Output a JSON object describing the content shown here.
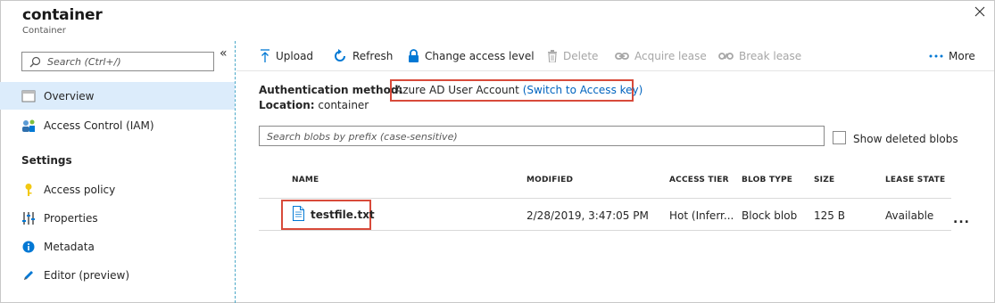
{
  "header": {
    "title": "container",
    "subtitle": "Container"
  },
  "sidebar": {
    "search_placeholder": "Search (Ctrl+/)",
    "collapse_glyph": "«",
    "items": [
      {
        "label": "Overview",
        "icon": "overview-icon"
      },
      {
        "label": "Access Control (IAM)",
        "icon": "iam-icon"
      }
    ],
    "settings_heading": "Settings",
    "settings_items": [
      {
        "label": "Access policy",
        "icon": "key-icon"
      },
      {
        "label": "Properties",
        "icon": "properties-icon"
      },
      {
        "label": "Metadata",
        "icon": "info-icon"
      },
      {
        "label": "Editor (preview)",
        "icon": "pencil-icon"
      }
    ]
  },
  "toolbar": {
    "upload": "Upload",
    "refresh": "Refresh",
    "change_access": "Change access level",
    "delete": "Delete",
    "acquire_lease": "Acquire lease",
    "break_lease": "Break lease",
    "more": "More"
  },
  "auth": {
    "label": "Authentication method:",
    "value": "Azure AD User Account",
    "switch_link": "(Switch to Access key)",
    "location_label": "Location:",
    "location_value": "container"
  },
  "blob_search": {
    "placeholder": "Search blobs by prefix (case-sensitive)",
    "show_deleted": "Show deleted blobs"
  },
  "table": {
    "columns": [
      "NAME",
      "MODIFIED",
      "ACCESS TIER",
      "BLOB TYPE",
      "SIZE",
      "LEASE STATE"
    ],
    "rows": [
      {
        "name": "testfile.txt",
        "modified": "2/28/2019, 3:47:05 PM",
        "access_tier": "Hot (Inferr...",
        "blob_type": "Block blob",
        "size": "125 B",
        "lease_state": "Available",
        "more": "..."
      }
    ]
  },
  "colors": {
    "accent": "#0064bf",
    "highlight_box": "#d84a3a",
    "active_nav": "#dcecfb"
  }
}
